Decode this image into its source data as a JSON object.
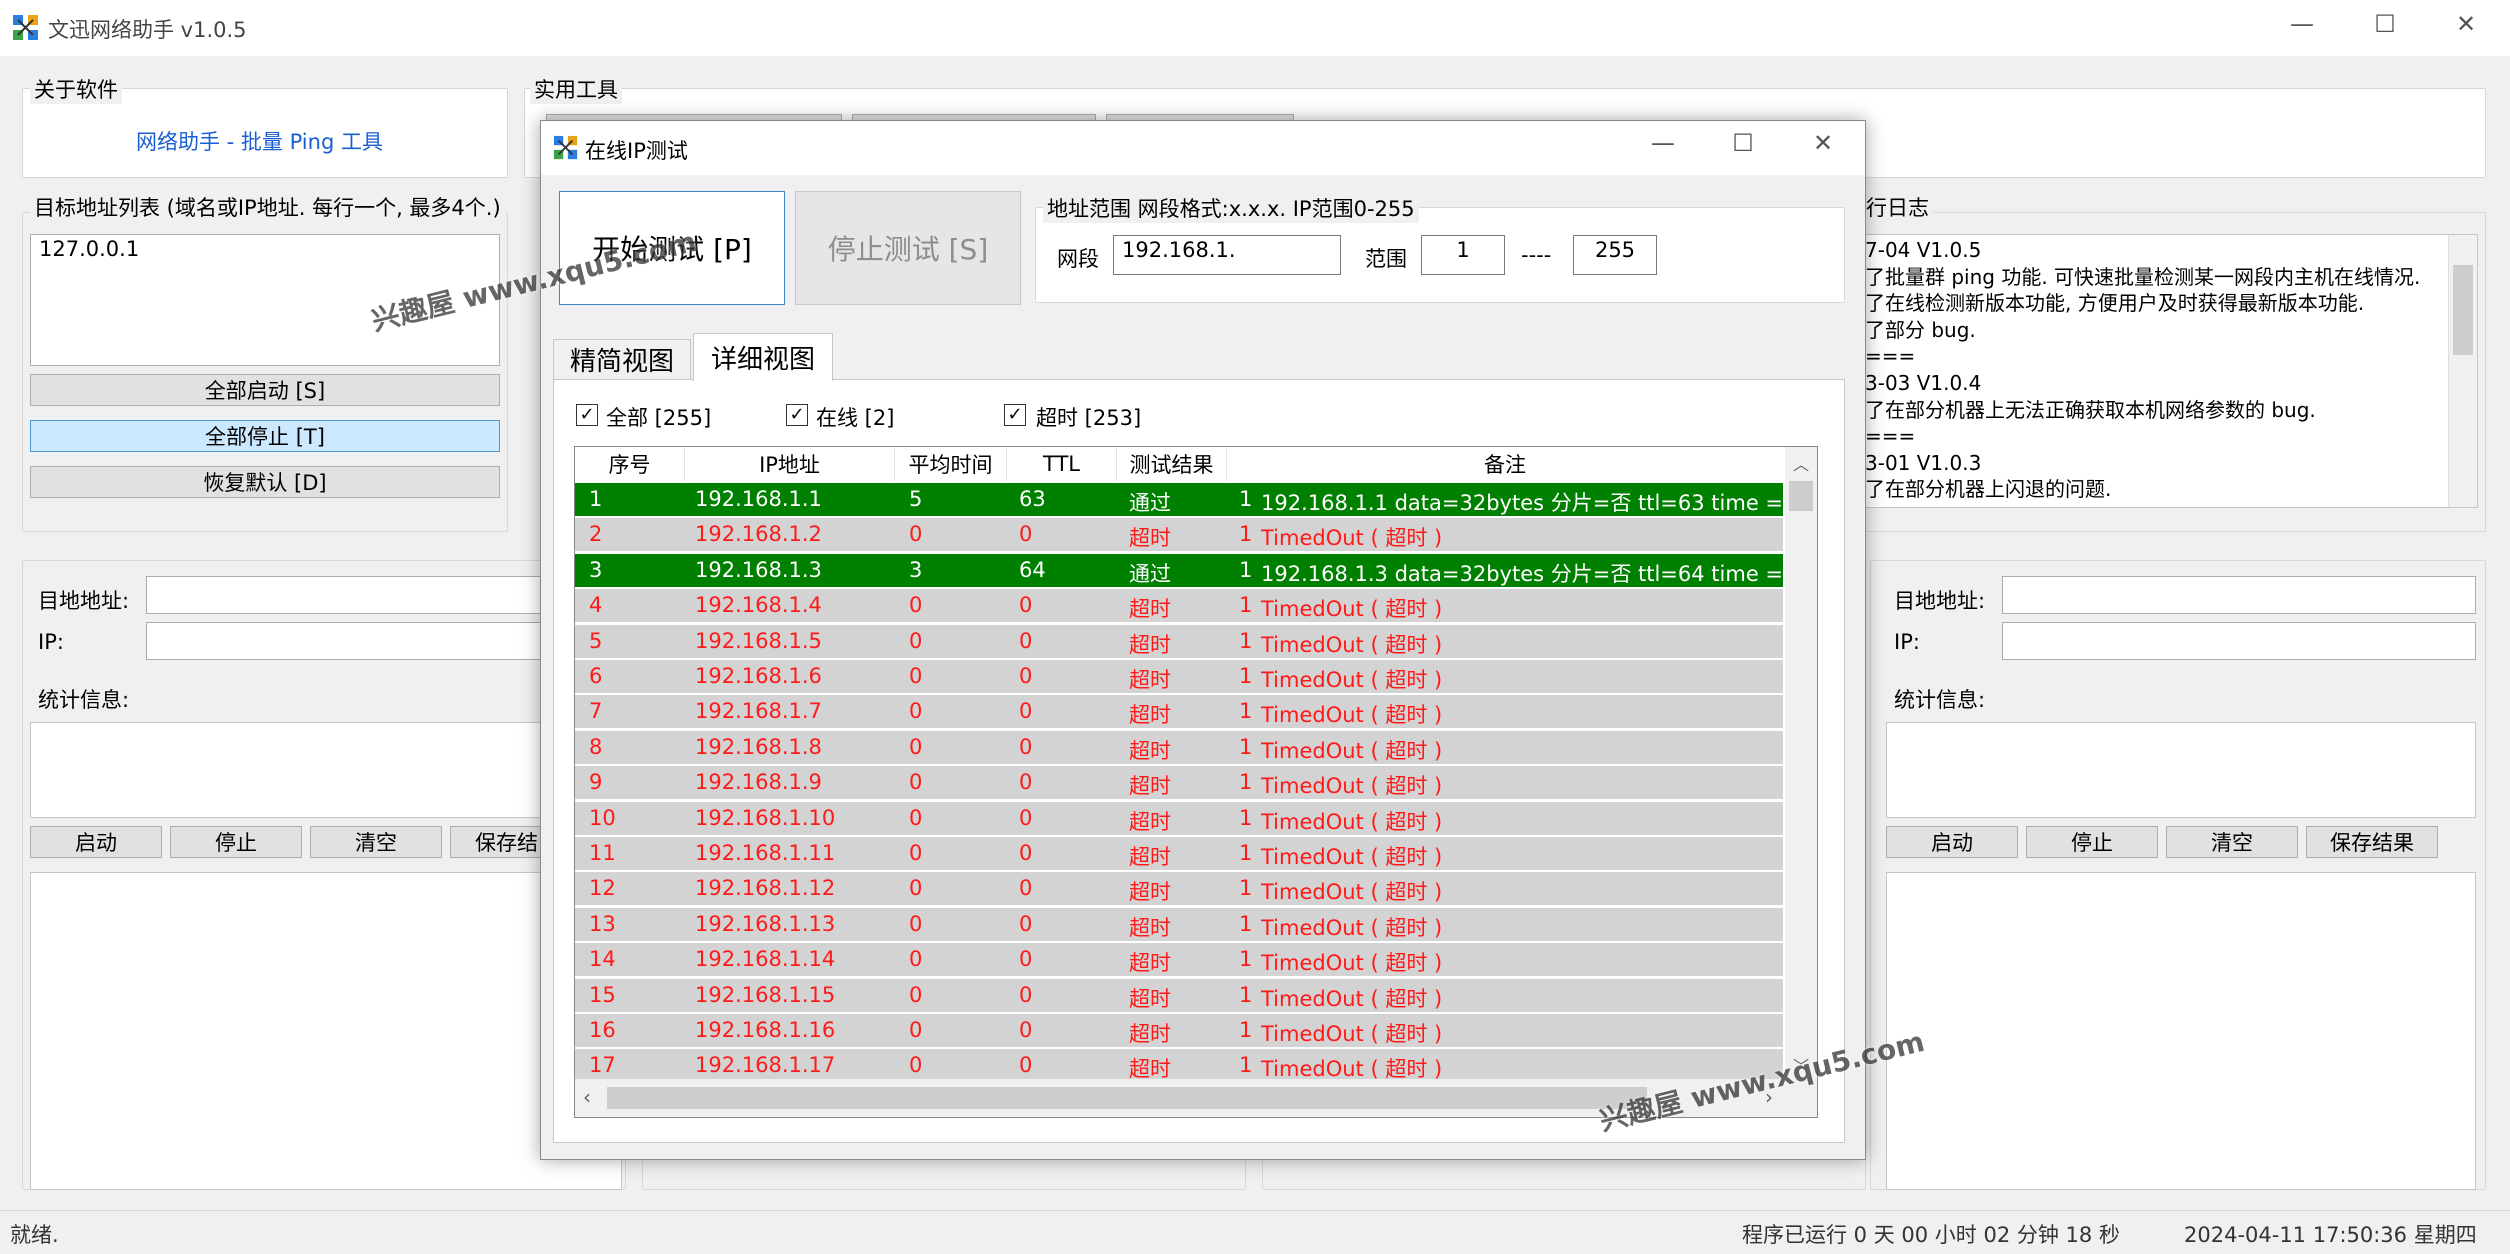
{
  "app": {
    "title": "文迅网络助手  v1.0.5"
  },
  "watermark": "兴趣屋 www.xqu5.com",
  "about": {
    "label": "关于软件",
    "link": "网络助手 - 批量 Ping 工具"
  },
  "tools": {
    "label": "实用工具"
  },
  "targets": {
    "label": "目标地址列表 (域名或IP地址. 每行一个, 最多4个.)",
    "value": "127.0.0.1",
    "start_all": "全部启动 [S]",
    "stop_all": "全部停止 [T]",
    "reset": "恢复默认 [D]"
  },
  "log": {
    "label": "行日志",
    "lines": [
      "7-04  V1.0.5",
      "了批量群 ping 功能. 可快速批量检测某一网段内主机在线情况.",
      "了在线检测新版本功能, 方便用户及时获得最新版本功能.",
      "了部分 bug.",
      "===",
      "3-03  V1.0.4",
      "了在部分机器上无法正确获取本机网络参数的 bug.",
      "===",
      "3-01  V1.0.3",
      "了在部分机器上闪退的问题."
    ]
  },
  "left_panel": {
    "target_label": "目地地址:",
    "ip_label": "IP:",
    "stats_label": "统计信息:",
    "start": "启动",
    "stop": "停止",
    "clear": "清空",
    "save": "保存结"
  },
  "right_panel": {
    "target_label": "目地地址:",
    "ip_label": "IP:",
    "stats_label": "统计信息:",
    "start": "启动",
    "stop": "停止",
    "clear": "清空",
    "save": "保存结果"
  },
  "status": {
    "left": "就绪.",
    "runtime": "程序已运行 0 天 00 小时 02 分钟 18 秒",
    "datetime": "2024-04-11 17:50:36 星期四"
  },
  "dialog": {
    "title": "在线IP测试",
    "start": "开始测试 [P]",
    "stop": "停止测试 [S]",
    "range_label": "地址范围  网段格式:x.x.x.  IP范围0-255",
    "segment_label": "网段",
    "segment_value": "192.168.1.",
    "range_text": "范围",
    "range_from": "1",
    "range_sep": "----",
    "range_to": "255",
    "tabs": [
      "精简视图",
      "详细视图"
    ],
    "filters": [
      "全部 [255]",
      "在线 [2]",
      "超时 [253]"
    ],
    "columns": [
      "序号",
      "IP地址",
      "平均时间",
      "TTL",
      "测试结果",
      "备注"
    ],
    "rows": [
      {
        "n": "1",
        "ip": "192.168.1.1",
        "avg": "5",
        "ttl": "63",
        "res": "通过",
        "c": "1",
        "note": "192.168.1.1  data=32bytes  分片=否  ttl=63  time =",
        "ok": true
      },
      {
        "n": "2",
        "ip": "192.168.1.2",
        "avg": "0",
        "ttl": "0",
        "res": "超时",
        "c": "1",
        "note": "TimedOut ( 超时 )",
        "ok": false
      },
      {
        "n": "3",
        "ip": "192.168.1.3",
        "avg": "3",
        "ttl": "64",
        "res": "通过",
        "c": "1",
        "note": "192.168.1.3  data=32bytes  分片=否  ttl=64  time =",
        "ok": true
      },
      {
        "n": "4",
        "ip": "192.168.1.4",
        "avg": "0",
        "ttl": "0",
        "res": "超时",
        "c": "1",
        "note": "TimedOut ( 超时 )",
        "ok": false
      },
      {
        "n": "5",
        "ip": "192.168.1.5",
        "avg": "0",
        "ttl": "0",
        "res": "超时",
        "c": "1",
        "note": "TimedOut ( 超时 )",
        "ok": false
      },
      {
        "n": "6",
        "ip": "192.168.1.6",
        "avg": "0",
        "ttl": "0",
        "res": "超时",
        "c": "1",
        "note": "TimedOut ( 超时 )",
        "ok": false
      },
      {
        "n": "7",
        "ip": "192.168.1.7",
        "avg": "0",
        "ttl": "0",
        "res": "超时",
        "c": "1",
        "note": "TimedOut ( 超时 )",
        "ok": false
      },
      {
        "n": "8",
        "ip": "192.168.1.8",
        "avg": "0",
        "ttl": "0",
        "res": "超时",
        "c": "1",
        "note": "TimedOut ( 超时 )",
        "ok": false
      },
      {
        "n": "9",
        "ip": "192.168.1.9",
        "avg": "0",
        "ttl": "0",
        "res": "超时",
        "c": "1",
        "note": "TimedOut ( 超时 )",
        "ok": false
      },
      {
        "n": "10",
        "ip": "192.168.1.10",
        "avg": "0",
        "ttl": "0",
        "res": "超时",
        "c": "1",
        "note": "TimedOut ( 超时 )",
        "ok": false
      },
      {
        "n": "11",
        "ip": "192.168.1.11",
        "avg": "0",
        "ttl": "0",
        "res": "超时",
        "c": "1",
        "note": "TimedOut ( 超时 )",
        "ok": false
      },
      {
        "n": "12",
        "ip": "192.168.1.12",
        "avg": "0",
        "ttl": "0",
        "res": "超时",
        "c": "1",
        "note": "TimedOut ( 超时 )",
        "ok": false
      },
      {
        "n": "13",
        "ip": "192.168.1.13",
        "avg": "0",
        "ttl": "0",
        "res": "超时",
        "c": "1",
        "note": "TimedOut ( 超时 )",
        "ok": false
      },
      {
        "n": "14",
        "ip": "192.168.1.14",
        "avg": "0",
        "ttl": "0",
        "res": "超时",
        "c": "1",
        "note": "TimedOut ( 超时 )",
        "ok": false
      },
      {
        "n": "15",
        "ip": "192.168.1.15",
        "avg": "0",
        "ttl": "0",
        "res": "超时",
        "c": "1",
        "note": "TimedOut ( 超时 )",
        "ok": false
      },
      {
        "n": "16",
        "ip": "192.168.1.16",
        "avg": "0",
        "ttl": "0",
        "res": "超时",
        "c": "1",
        "note": "TimedOut ( 超时 )",
        "ok": false
      },
      {
        "n": "17",
        "ip": "192.168.1.17",
        "avg": "0",
        "ttl": "0",
        "res": "超时",
        "c": "1",
        "note": "TimedOut ( 超时 )",
        "ok": false
      }
    ]
  },
  "colors": {
    "pass_row": "#008000",
    "fail_text": "#ff1a1a",
    "fail_row": "#d3d3d3",
    "link": "#1a5fd1"
  }
}
